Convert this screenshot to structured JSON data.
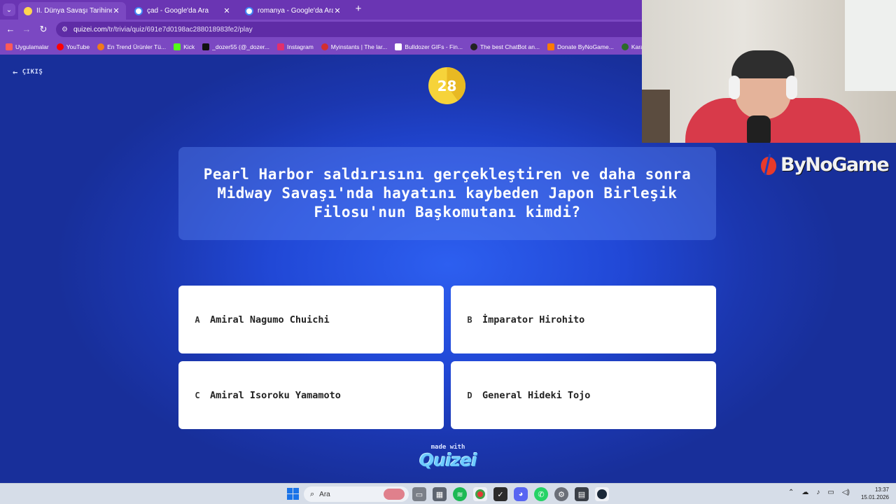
{
  "browser": {
    "tabs": [
      {
        "title": "II. Dünya Savaşı Tarihine Ne Kad",
        "favicon": "quizei-favicon",
        "active": true
      },
      {
        "title": "çad - Google'da Ara",
        "favicon": "google-favicon",
        "active": false
      },
      {
        "title": "romanya - Google'da Ara",
        "favicon": "google-favicon",
        "active": false
      }
    ],
    "new_tab_label": "+",
    "url_domain": "quizei.com",
    "url_path": "/tr/trivia/quiz/691e7d0198ac288018983fe2/play",
    "bookmarks": [
      {
        "label": "Uygulamalar",
        "icon": "apps-grid-icon",
        "color": "#ff5a5a"
      },
      {
        "label": "YouTube",
        "icon": "youtube-icon",
        "color": "#ff0000"
      },
      {
        "label": "En Trend Ürünler Tü...",
        "icon": "trendyol-icon",
        "color": "#f27a1a"
      },
      {
        "label": "Kick",
        "icon": "kick-icon",
        "color": "#53fc18"
      },
      {
        "label": "_dozer55 (@_dozer...",
        "icon": "tiktok-icon",
        "color": "#111111"
      },
      {
        "label": "Instagram",
        "icon": "instagram-icon",
        "color": "#e1306c"
      },
      {
        "label": "Myinstants | The lar...",
        "icon": "myinstants-icon",
        "color": "#d32f2f"
      },
      {
        "label": "Bulldozer GIFs - Fin...",
        "icon": "page-icon",
        "color": "#ffffff"
      },
      {
        "label": "The best ChatBot an...",
        "icon": "chatbot-icon",
        "color": "#222222"
      },
      {
        "label": "Donate ByNoGame...",
        "icon": "bynogame-icon",
        "color": "#ff7a00"
      },
      {
        "label": "Karatay Belediy",
        "icon": "karatay-icon",
        "color": "#2b6b2b"
      }
    ]
  },
  "quiz": {
    "exit_label": "ÇIKIŞ",
    "timer": "28",
    "timer_fraction": 0.4,
    "question": "Pearl Harbor saldırısını gerçekleştiren ve daha sonra Midway Savaşı'nda hayatını kaybeden Japon Birleşik Filosu'nun Başkomutanı kimdi?",
    "answers": [
      {
        "key": "A",
        "text": "Amiral Nagumo Chuichi"
      },
      {
        "key": "B",
        "text": "İmparator Hirohito"
      },
      {
        "key": "C",
        "text": "Amiral Isoroku Yamamoto"
      },
      {
        "key": "D",
        "text": "General Hideki Tojo"
      }
    ],
    "made_with": "made with",
    "brand": "Quizei"
  },
  "overlay": {
    "sponsor": "ByNoGame"
  },
  "taskbar": {
    "search_label": "Ara",
    "apps": [
      "file-explorer-icon",
      "store-icon",
      "spotify-icon",
      "chrome-icon",
      "vectorworks-icon",
      "discord-icon",
      "whatsapp-icon",
      "settings-icon",
      "terminal-icon",
      "steam-icon"
    ],
    "time": "13:37",
    "date": "15.01.2026"
  },
  "colors": {
    "accent": "#6a35b3",
    "quiz_bg": "#2148d6",
    "timer": "#f6d33a"
  }
}
